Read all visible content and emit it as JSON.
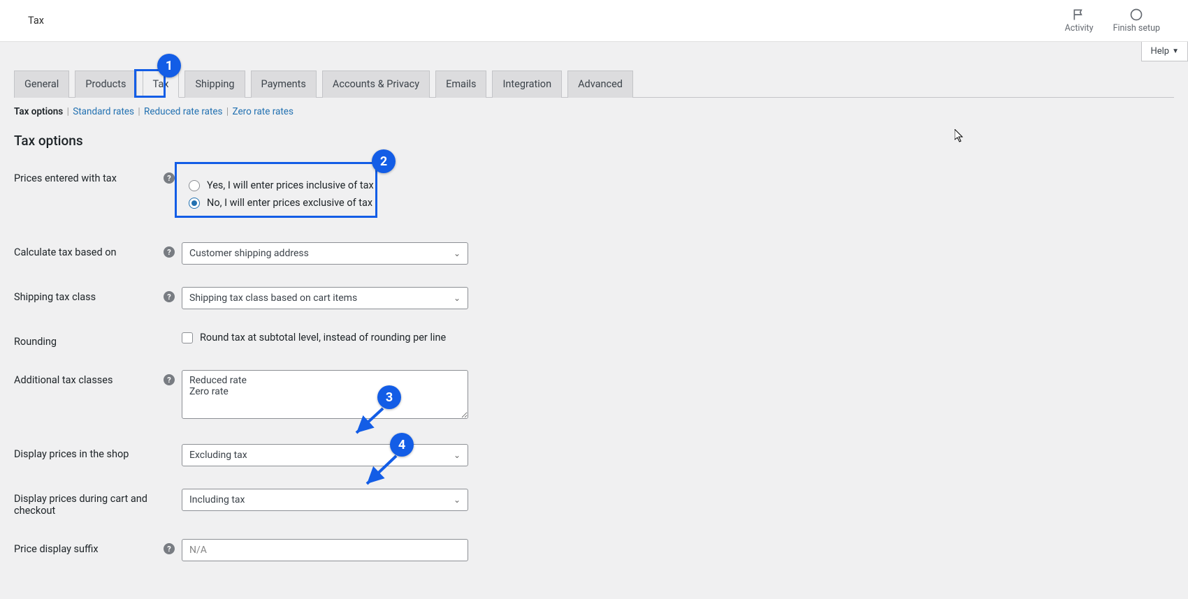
{
  "topbar": {
    "title": "Tax",
    "activity": "Activity",
    "finish_setup": "Finish setup"
  },
  "help_button": "Help",
  "tabs": {
    "general": "General",
    "products": "Products",
    "tax": "Tax",
    "shipping": "Shipping",
    "payments": "Payments",
    "accounts": "Accounts & Privacy",
    "emails": "Emails",
    "integration": "Integration",
    "advanced": "Advanced"
  },
  "subtabs": {
    "tax_options": "Tax options",
    "standard": "Standard rates",
    "reduced": "Reduced rate rates",
    "zero": "Zero rate rates"
  },
  "section_title": "Tax options",
  "labels": {
    "prices_with_tax": "Prices entered with tax",
    "calc_based_on": "Calculate tax based on",
    "shipping_tax_class": "Shipping tax class",
    "rounding": "Rounding",
    "additional_classes": "Additional tax classes",
    "display_shop": "Display prices in the shop",
    "display_cart": "Display prices during cart and checkout",
    "price_suffix": "Price display suffix"
  },
  "radios": {
    "inclusive": "Yes, I will enter prices inclusive of tax",
    "exclusive": "No, I will enter prices exclusive of tax"
  },
  "selects": {
    "calc_based_on": "Customer shipping address",
    "shipping_tax_class": "Shipping tax class based on cart items",
    "display_shop": "Excluding tax",
    "display_cart": "Including tax"
  },
  "rounding_checkbox": "Round tax at subtotal level, instead of rounding per line",
  "additional_classes_value": "Reduced rate\nZero rate",
  "price_suffix_placeholder": "N/A",
  "annotations": {
    "n1": "1",
    "n2": "2",
    "n3": "3",
    "n4": "4"
  }
}
